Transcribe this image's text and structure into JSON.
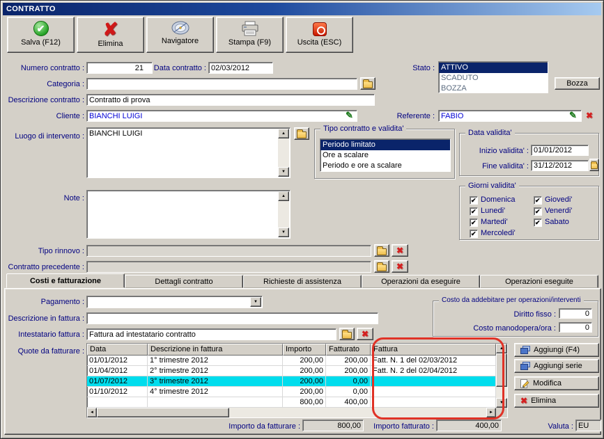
{
  "window": {
    "title": "CONTRATTO"
  },
  "colors": {
    "accent_navy": "#000080",
    "selection_blue": "#0a246a",
    "selection_cyan": "#00dded",
    "annotation_red": "#e03226",
    "link_blue": "#0000d4"
  },
  "toolbar": {
    "buttons": [
      {
        "label": "Salva (F12)",
        "icon": "save-check-icon"
      },
      {
        "label": "Elimina",
        "icon": "delete-x-icon"
      },
      {
        "label": "Navigatore",
        "icon": "navigator-compass-icon"
      },
      {
        "label": "Stampa (F9)",
        "icon": "printer-icon"
      },
      {
        "label": "Uscita (ESC)",
        "icon": "exit-power-icon"
      }
    ]
  },
  "form": {
    "numero_contratto": {
      "label": "Numero contratto :",
      "value": "21"
    },
    "data_contratto": {
      "label": "Data contratto :",
      "value": "02/03/2012"
    },
    "stato": {
      "label": "Stato :",
      "options": [
        "ATTIVO",
        "SCADUTO",
        "BOZZA"
      ],
      "selected": "ATTIVO"
    },
    "bozza_button_label": "Bozza",
    "categoria": {
      "label": "Categoria :",
      "value": ""
    },
    "descrizione_contratto": {
      "label": "Descrizione contratto :",
      "value": "Contratto di prova"
    },
    "cliente": {
      "label": "Cliente :",
      "value": "BIANCHI LUIGI"
    },
    "referente": {
      "label": "Referente :",
      "value": "FABIO"
    },
    "luogo_intervento": {
      "label": "Luogo di intervento :",
      "value": "BIANCHI LUIGI"
    },
    "tipo_contratto": {
      "title": "Tipo contratto e validita'",
      "options": [
        "Periodo limitato",
        "Ore a scalare",
        "Periodo e ore a scalare"
      ],
      "selected": "Periodo limitato"
    },
    "data_validita": {
      "title": "Data validita'",
      "inizio_label": "Inizio validita' :",
      "inizio_value": "01/01/2012",
      "fine_label": "Fine validita' :",
      "fine_value": "31/12/2012"
    },
    "giorni_validita": {
      "title": "Giorni validita'",
      "days_col1": [
        "Domenica",
        "Lunedi'",
        "Martedi'",
        "Mercoledi'"
      ],
      "days_col2": [
        "Giovedi'",
        "Venerdi'",
        "Sabato"
      ],
      "all_checked": true
    },
    "note": {
      "label": "Note :",
      "value": ""
    },
    "tipo_rinnovo": {
      "label": "Tipo rinnovo :",
      "value": ""
    },
    "contratto_precedente": {
      "label": "Contratto precedente :",
      "value": ""
    }
  },
  "tabs": [
    "Costi e fatturazione",
    "Dettagli contratto",
    "Richieste di assistenza",
    "Operazioni da eseguire",
    "Operazioni eseguite"
  ],
  "active_tab": "Costi e fatturazione",
  "costi_tab": {
    "pagamento": {
      "label": "Pagamento :",
      "value": ""
    },
    "descrizione_in_fattura": {
      "label": "Descrizione in fattura :",
      "value": ""
    },
    "intestatario_fattura": {
      "label": "Intestatario fattura :",
      "value": "Fattura ad intestatario contratto"
    },
    "costo_group": {
      "title": "Costo da addebitare per operazioni/interventi",
      "diritto_fisso_label": "Diritto fisso :",
      "diritto_fisso_value": "0",
      "costo_manodopera_label": "Costo manodopera/ora :",
      "costo_manodopera_value": "0"
    },
    "quote": {
      "label": "Quote da fatturare :",
      "columns": [
        "Data",
        "Descrizione in fattura",
        "Importo",
        "Fatturato",
        "Fattura"
      ],
      "rows": [
        [
          "01/01/2012",
          "1° trimestre 2012",
          "200,00",
          "200,00",
          "Fatt. N. 1 del 02/03/2012"
        ],
        [
          "01/04/2012",
          "2° trimestre 2012",
          "200,00",
          "200,00",
          "Fatt. N. 2 del 02/04/2012"
        ],
        [
          "01/07/2012",
          "3° trimestre 2012",
          "200,00",
          "0,00",
          ""
        ],
        [
          "01/10/2012",
          "4° trimestre 2012",
          "200,00",
          "0,00",
          ""
        ],
        [
          "",
          "",
          "800,00",
          "400,00",
          ""
        ]
      ],
      "selected_row_index": 2
    },
    "side_buttons": [
      {
        "label": "Aggiungi (F4)",
        "icon": "add-icon"
      },
      {
        "label": "Aggiungi serie",
        "icon": "add-series-icon"
      },
      {
        "label": "Modifica",
        "icon": "edit-pencil-icon"
      },
      {
        "label": "Elimina",
        "icon": "delete-x-icon"
      }
    ],
    "totals": {
      "importo_da_fatturare_label": "Importo da fatturare :",
      "importo_da_fatturare_value": "800,00",
      "importo_fatturato_label": "Importo fatturato :",
      "importo_fatturato_value": "400,00",
      "valuta_label": "Valuta :",
      "valuta_value": "EU"
    }
  }
}
